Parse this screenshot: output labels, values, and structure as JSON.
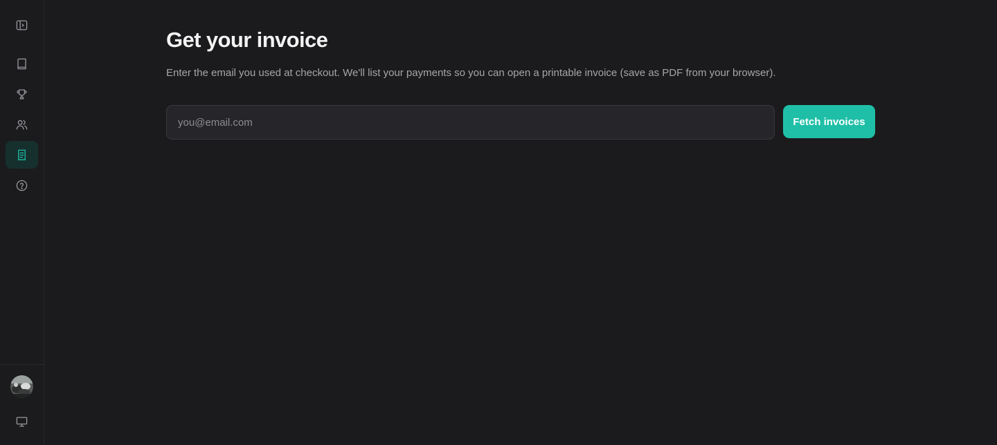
{
  "sidebar": {
    "items": [
      {
        "icon": "sidebar-toggle-icon",
        "active": false
      },
      {
        "icon": "book-icon",
        "active": false
      },
      {
        "icon": "trophy-icon",
        "active": false
      },
      {
        "icon": "users-icon",
        "active": false
      },
      {
        "icon": "receipt-icon",
        "active": true
      },
      {
        "icon": "help-circle-icon",
        "active": false
      }
    ],
    "footer": [
      {
        "icon": "avatar"
      },
      {
        "icon": "monitor-icon"
      }
    ]
  },
  "page": {
    "title": "Get your invoice",
    "subtitle": "Enter the email you used at checkout. We'll list your payments so you can open a printable invoice (save as PDF from your browser).",
    "email_placeholder": "you@email.com",
    "email_value": "",
    "fetch_label": "Fetch invoices"
  },
  "colors": {
    "background": "#1b1b1d",
    "accent": "#1fbfa7",
    "active_bg": "#16302d",
    "input_bg": "#26262a"
  }
}
